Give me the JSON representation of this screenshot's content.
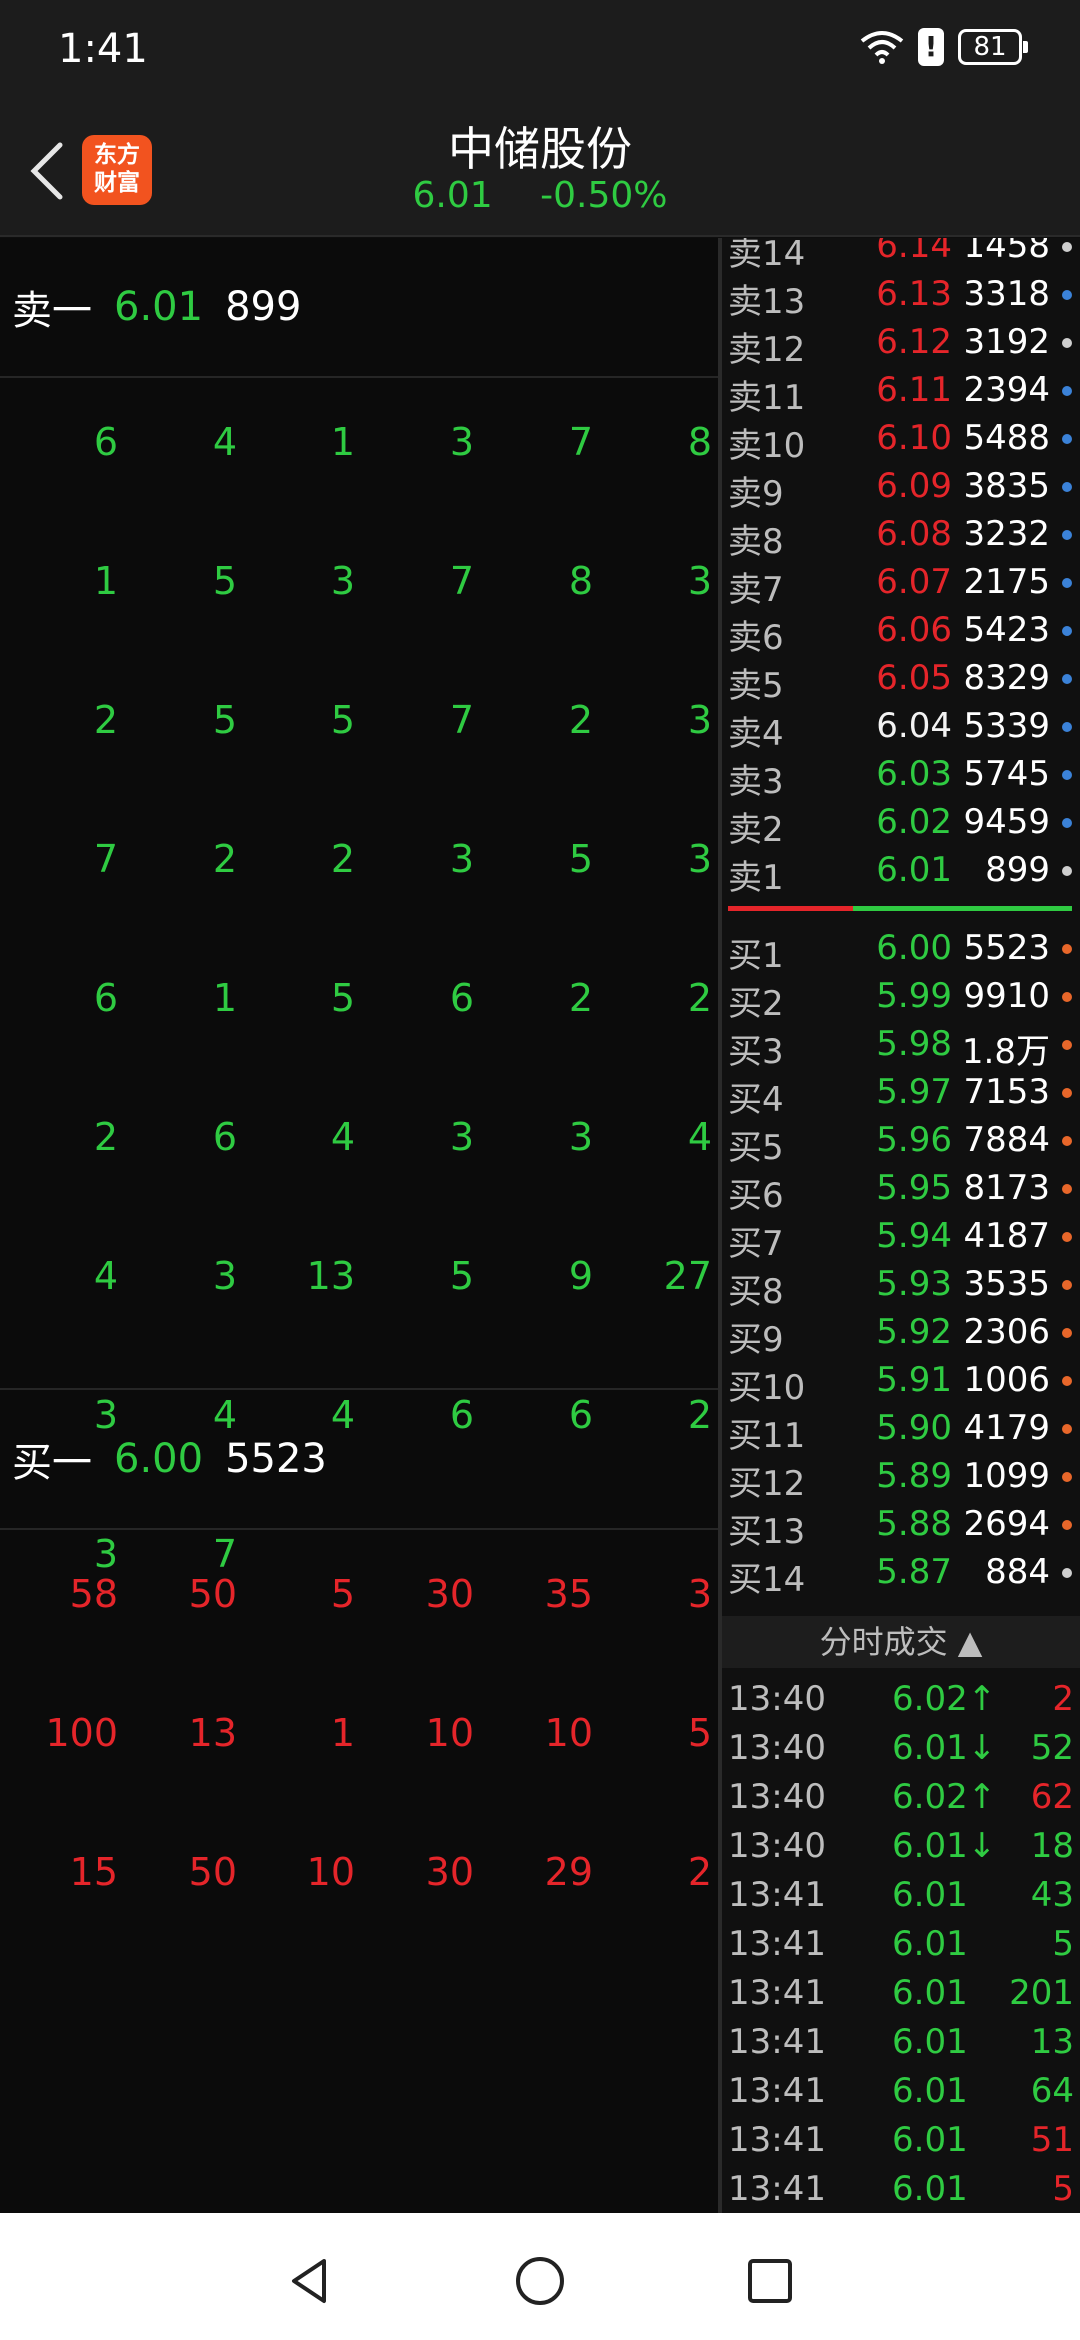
{
  "status": {
    "time": "1:41",
    "battery": "81",
    "alert": "!"
  },
  "header": {
    "title": "中储股份",
    "price": "6.01",
    "change": "-0.50%",
    "logo_line1": "东方",
    "logo_line2": "财富"
  },
  "left": {
    "sell": {
      "label": "卖一",
      "price": "6.01",
      "volume": "899"
    },
    "sell_grid": [
      [
        "6",
        "4",
        "1",
        "3",
        "7",
        "8"
      ],
      [
        "1",
        "5",
        "3",
        "7",
        "8",
        "3"
      ],
      [
        "2",
        "5",
        "5",
        "7",
        "2",
        "3"
      ],
      [
        "7",
        "2",
        "2",
        "3",
        "5",
        "3"
      ],
      [
        "6",
        "1",
        "5",
        "6",
        "2",
        "2"
      ],
      [
        "2",
        "6",
        "4",
        "3",
        "3",
        "4"
      ],
      [
        "4",
        "3",
        "13",
        "5",
        "9",
        "27"
      ],
      [
        "3",
        "4",
        "4",
        "6",
        "6",
        "2"
      ],
      [
        "3",
        "7",
        "",
        "",
        "",
        ""
      ]
    ],
    "buy": {
      "label": "买一",
      "price": "6.00",
      "volume": "5523"
    },
    "buy_grid": [
      [
        "58",
        "50",
        "5",
        "30",
        "35",
        "3"
      ],
      [
        "100",
        "13",
        "1",
        "10",
        "10",
        "5"
      ],
      [
        "15",
        "50",
        "10",
        "30",
        "29",
        "2"
      ]
    ]
  },
  "orderbook": {
    "asks": [
      {
        "label": "卖14",
        "price": "6.14",
        "vol": "1458",
        "pc": "red",
        "dot": "#cfcfcf"
      },
      {
        "label": "卖13",
        "price": "6.13",
        "vol": "3318",
        "pc": "red",
        "dot": "#3b82d8"
      },
      {
        "label": "卖12",
        "price": "6.12",
        "vol": "3192",
        "pc": "red",
        "dot": "#cfcfcf"
      },
      {
        "label": "卖11",
        "price": "6.11",
        "vol": "2394",
        "pc": "red",
        "dot": "#3b82d8"
      },
      {
        "label": "卖10",
        "price": "6.10",
        "vol": "5488",
        "pc": "red",
        "dot": "#3b82d8"
      },
      {
        "label": "卖9",
        "price": "6.09",
        "vol": "3835",
        "pc": "red",
        "dot": "#3b82d8"
      },
      {
        "label": "卖8",
        "price": "6.08",
        "vol": "3232",
        "pc": "red",
        "dot": "#3b82d8"
      },
      {
        "label": "卖7",
        "price": "6.07",
        "vol": "2175",
        "pc": "red",
        "dot": "#3b82d8"
      },
      {
        "label": "卖6",
        "price": "6.06",
        "vol": "5423",
        "pc": "red",
        "dot": "#3b82d8"
      },
      {
        "label": "卖5",
        "price": "6.05",
        "vol": "8329",
        "pc": "red",
        "dot": "#3b82d8"
      },
      {
        "label": "卖4",
        "price": "6.04",
        "vol": "5339",
        "pc": "white",
        "dot": "#3b82d8"
      },
      {
        "label": "卖3",
        "price": "6.03",
        "vol": "5745",
        "pc": "green",
        "dot": "#3b82d8"
      },
      {
        "label": "卖2",
        "price": "6.02",
        "vol": "9459",
        "pc": "green",
        "dot": "#3b82d8"
      },
      {
        "label": "卖1",
        "price": "6.01",
        "vol": "899",
        "pc": "green",
        "dot": "#cfcfcf"
      }
    ],
    "bids": [
      {
        "label": "买1",
        "price": "6.00",
        "vol": "5523",
        "pc": "green",
        "dot": "#e8672a"
      },
      {
        "label": "买2",
        "price": "5.99",
        "vol": "9910",
        "pc": "green",
        "dot": "#e8672a"
      },
      {
        "label": "买3",
        "price": "5.98",
        "vol": "1.8万",
        "pc": "green",
        "dot": "#e8672a"
      },
      {
        "label": "买4",
        "price": "5.97",
        "vol": "7153",
        "pc": "green",
        "dot": "#e8672a"
      },
      {
        "label": "买5",
        "price": "5.96",
        "vol": "7884",
        "pc": "green",
        "dot": "#e8672a"
      },
      {
        "label": "买6",
        "price": "5.95",
        "vol": "8173",
        "pc": "green",
        "dot": "#e8672a"
      },
      {
        "label": "买7",
        "price": "5.94",
        "vol": "4187",
        "pc": "green",
        "dot": "#e8672a"
      },
      {
        "label": "买8",
        "price": "5.93",
        "vol": "3535",
        "pc": "green",
        "dot": "#e8672a"
      },
      {
        "label": "买9",
        "price": "5.92",
        "vol": "2306",
        "pc": "green",
        "dot": "#e8672a"
      },
      {
        "label": "买10",
        "price": "5.91",
        "vol": "1006",
        "pc": "green",
        "dot": "#e8672a"
      },
      {
        "label": "买11",
        "price": "5.90",
        "vol": "4179",
        "pc": "green",
        "dot": "#e8672a"
      },
      {
        "label": "买12",
        "price": "5.89",
        "vol": "1099",
        "pc": "green",
        "dot": "#e8672a"
      },
      {
        "label": "买13",
        "price": "5.88",
        "vol": "2694",
        "pc": "green",
        "dot": "#e8672a"
      },
      {
        "label": "买14",
        "price": "5.87",
        "vol": "884",
        "pc": "green",
        "dot": "#cfcfcf"
      }
    ]
  },
  "ticks": {
    "title": "分时成交",
    "rows": [
      {
        "time": "13:40",
        "price": "6.02↑",
        "vol": "2",
        "pc": "green",
        "vc": "red"
      },
      {
        "time": "13:40",
        "price": "6.01↓",
        "vol": "52",
        "pc": "green",
        "vc": "green"
      },
      {
        "time": "13:40",
        "price": "6.02↑",
        "vol": "62",
        "pc": "green",
        "vc": "red"
      },
      {
        "time": "13:40",
        "price": "6.01↓",
        "vol": "18",
        "pc": "green",
        "vc": "green"
      },
      {
        "time": "13:41",
        "price": "6.01",
        "vol": "43",
        "pc": "green",
        "vc": "green"
      },
      {
        "time": "13:41",
        "price": "6.01",
        "vol": "5",
        "pc": "green",
        "vc": "green"
      },
      {
        "time": "13:41",
        "price": "6.01",
        "vol": "201",
        "pc": "green",
        "vc": "green"
      },
      {
        "time": "13:41",
        "price": "6.01",
        "vol": "13",
        "pc": "green",
        "vc": "green"
      },
      {
        "time": "13:41",
        "price": "6.01",
        "vol": "64",
        "pc": "green",
        "vc": "green"
      },
      {
        "time": "13:41",
        "price": "6.01",
        "vol": "51",
        "pc": "green",
        "vc": "red"
      },
      {
        "time": "13:41",
        "price": "6.01",
        "vol": "5",
        "pc": "green",
        "vc": "red"
      }
    ]
  }
}
